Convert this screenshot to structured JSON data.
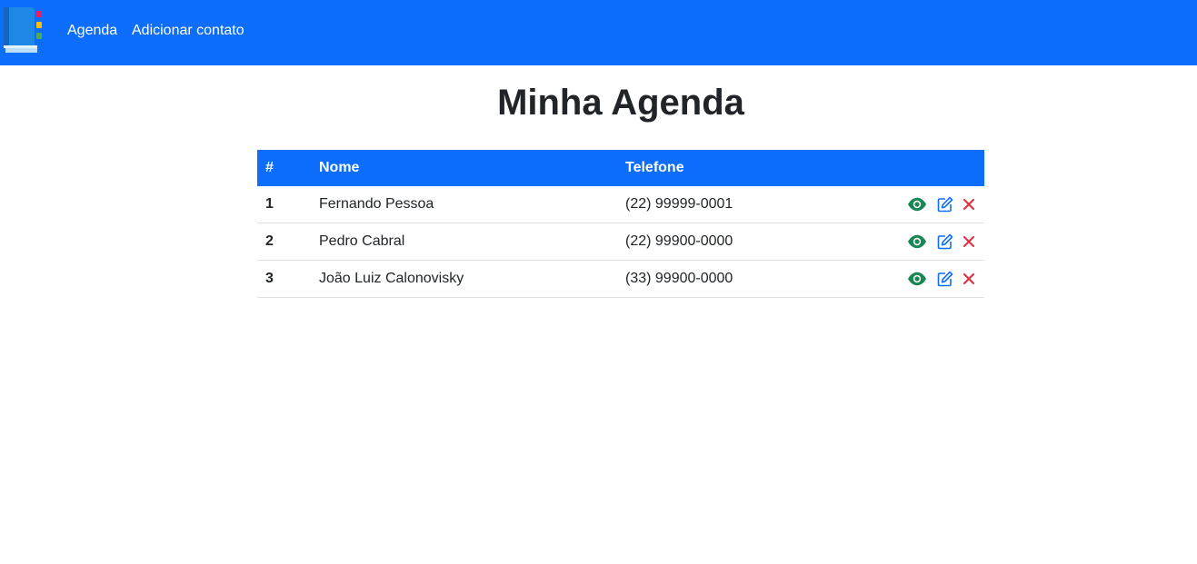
{
  "navbar": {
    "links": [
      {
        "label": "Agenda"
      },
      {
        "label": "Adicionar contato"
      }
    ],
    "colors": {
      "background": "#0d6efd",
      "text": "#ffffff"
    }
  },
  "main": {
    "title": "Minha Agenda"
  },
  "table": {
    "headers": [
      "#",
      "Nome",
      "Telefone"
    ],
    "rows": [
      {
        "id": "1",
        "name": "Fernando Pessoa",
        "phone": "(22) 99999-0001"
      },
      {
        "id": "2",
        "name": "Pedro Cabral",
        "phone": "(22) 99900-0000"
      },
      {
        "id": "3",
        "name": "João Luiz Calonovisky",
        "phone": "(33) 99900-0000"
      }
    ],
    "row_actions": [
      "eye-icon",
      "edit-icon",
      "close-icon"
    ],
    "colors": {
      "header": "#0d6efd",
      "view": "#198754",
      "edit": "#0d6efd",
      "delete": "#dc3545"
    }
  }
}
